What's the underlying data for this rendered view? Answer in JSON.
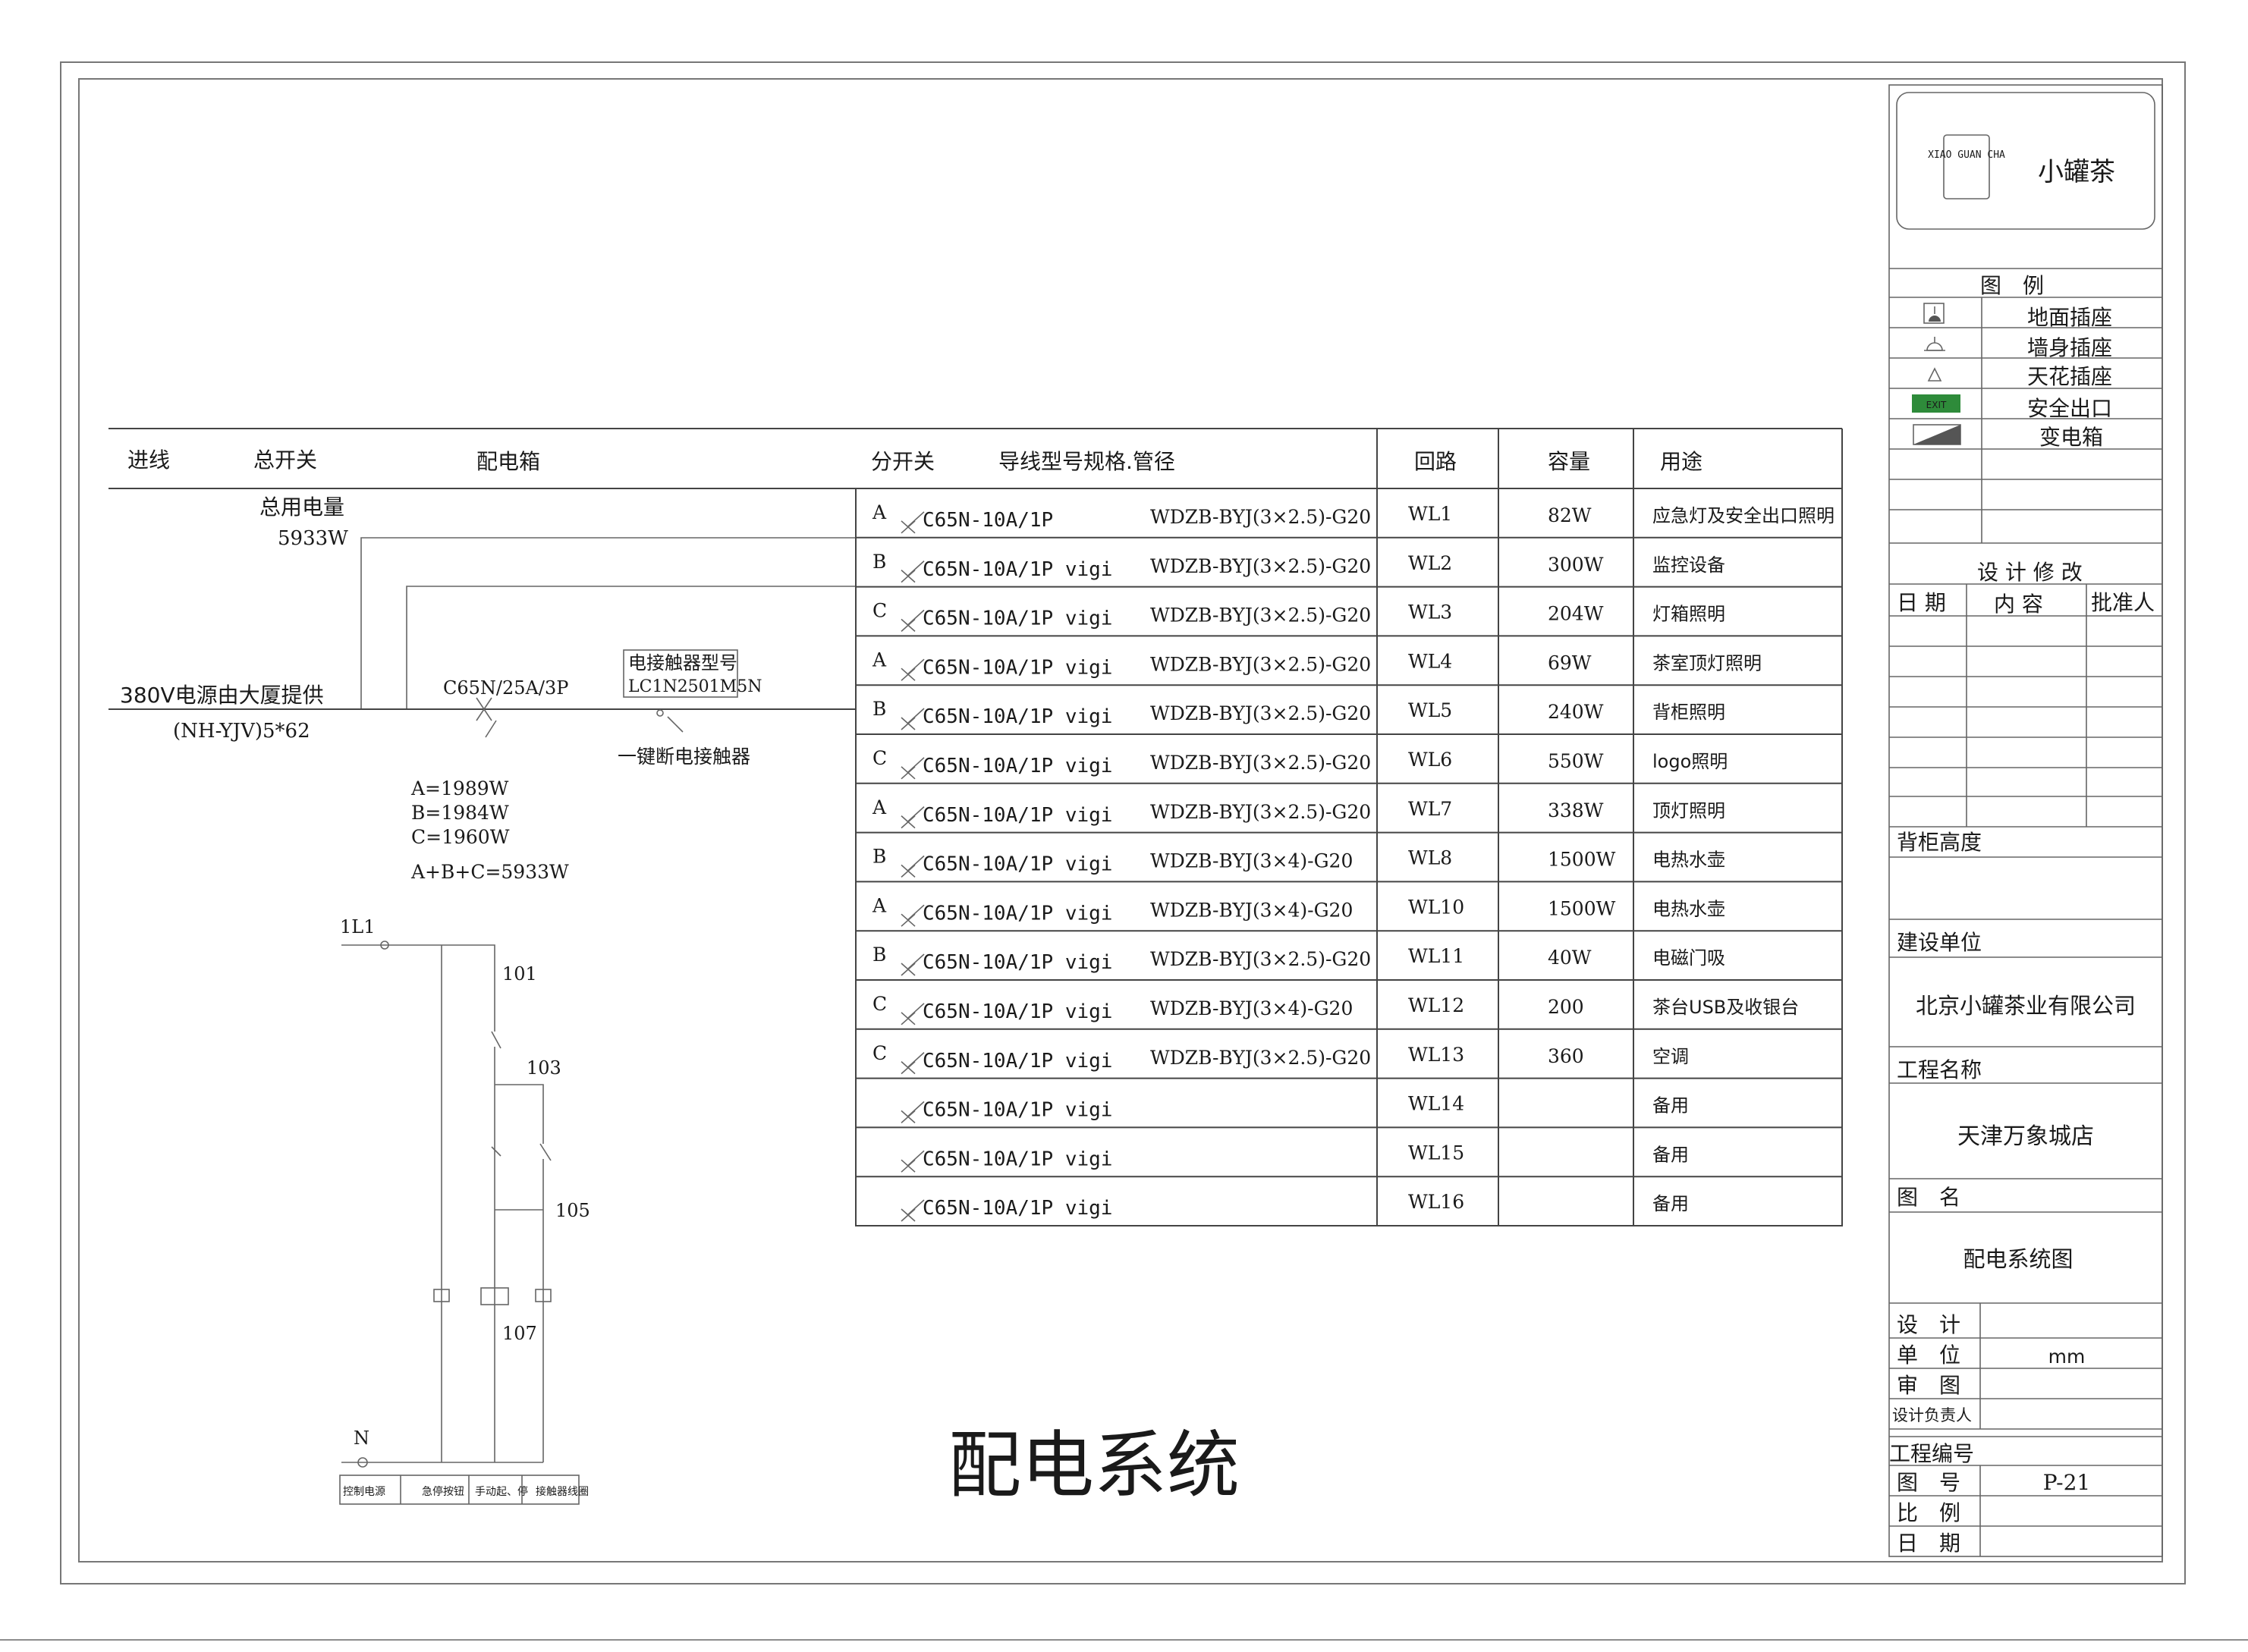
{
  "header": {
    "incoming": "进线",
    "main_switch": "总开关",
    "distribution_box": "配电箱",
    "branch_switch": "分开关",
    "wire_spec": "导线型号规格.管径",
    "circuit": "回路",
    "capacity": "容量",
    "usage": "用途"
  },
  "total_power": {
    "label": "总用电量",
    "value": "5933W"
  },
  "supply": {
    "text": "380V电源由大厦提供",
    "cable": "(NH-YJV)5*62"
  },
  "main_breaker": "C65N/25A/3P",
  "contactor": {
    "title": "电接触器型号",
    "model": "LC1N2501M5N",
    "caption": "一键断电接触器"
  },
  "phase_loads": {
    "a": "A=1989W",
    "b": "B=1984W",
    "c": "C=1960W",
    "total": "A+B+C=5933W"
  },
  "circuits": [
    {
      "phase": "A",
      "breaker": "C65N-10A/1P",
      "wire": "WDZB-BYJ(3×2.5)-G20",
      "id": "WL1",
      "capacity": "82W",
      "usage": "应急灯及安全出口照明"
    },
    {
      "phase": "B",
      "breaker": "C65N-10A/1P vigi",
      "wire": "WDZB-BYJ(3×2.5)-G20",
      "id": "WL2",
      "capacity": "300W",
      "usage": "监控设备"
    },
    {
      "phase": "C",
      "breaker": "C65N-10A/1P vigi",
      "wire": "WDZB-BYJ(3×2.5)-G20",
      "id": "WL3",
      "capacity": "204W",
      "usage": "灯箱照明"
    },
    {
      "phase": "A",
      "breaker": "C65N-10A/1P vigi",
      "wire": "WDZB-BYJ(3×2.5)-G20",
      "id": "WL4",
      "capacity": "69W",
      "usage": "茶室顶灯照明"
    },
    {
      "phase": "B",
      "breaker": "C65N-10A/1P vigi",
      "wire": "WDZB-BYJ(3×2.5)-G20",
      "id": "WL5",
      "capacity": "240W",
      "usage": "背柜照明"
    },
    {
      "phase": "C",
      "breaker": "C65N-10A/1P vigi",
      "wire": "WDZB-BYJ(3×2.5)-G20",
      "id": "WL6",
      "capacity": "550W",
      "usage": "logo照明"
    },
    {
      "phase": "A",
      "breaker": "C65N-10A/1P vigi",
      "wire": "WDZB-BYJ(3×2.5)-G20",
      "id": "WL7",
      "capacity": "338W",
      "usage": "顶灯照明"
    },
    {
      "phase": "B",
      "breaker": "C65N-10A/1P vigi",
      "wire": "WDZB-BYJ(3×4)-G20",
      "id": "WL8",
      "capacity": "1500W",
      "usage": "电热水壶"
    },
    {
      "phase": "A",
      "breaker": "C65N-10A/1P vigi",
      "wire": "WDZB-BYJ(3×4)-G20",
      "id": "WL10",
      "capacity": "1500W",
      "usage": "电热水壶"
    },
    {
      "phase": "B",
      "breaker": "C65N-10A/1P vigi",
      "wire": "WDZB-BYJ(3×2.5)-G20",
      "id": "WL11",
      "capacity": "40W",
      "usage": "电磁门吸"
    },
    {
      "phase": "C",
      "breaker": "C65N-10A/1P vigi",
      "wire": "WDZB-BYJ(3×4)-G20",
      "id": "WL12",
      "capacity": "200",
      "usage": "茶台USB及收银台"
    },
    {
      "phase": "C",
      "breaker": "C65N-10A/1P vigi",
      "wire": "WDZB-BYJ(3×2.5)-G20",
      "id": "WL13",
      "capacity": "360",
      "usage": "空调"
    },
    {
      "phase": "",
      "breaker": "C65N-10A/1P vigi",
      "wire": "",
      "id": "WL14",
      "capacity": "",
      "usage": "备用"
    },
    {
      "phase": "",
      "breaker": "C65N-10A/1P vigi",
      "wire": "",
      "id": "WL15",
      "capacity": "",
      "usage": "备用"
    },
    {
      "phase": "",
      "breaker": "C65N-10A/1P vigi",
      "wire": "",
      "id": "WL16",
      "capacity": "",
      "usage": "备用"
    }
  ],
  "control": {
    "l1": "1L1",
    "n": "N",
    "wires": [
      "101",
      "103",
      "105",
      "107"
    ],
    "legend": [
      "控制电源",
      "急停按钮",
      "手动起、停",
      "接触器线圈"
    ]
  },
  "title": "配电系统",
  "titleblock": {
    "logo_brand": "小罐茶",
    "logo_mark": "XIAO GUAN CHA",
    "legend_title": "图　例",
    "legend_items": [
      "地面插座",
      "墙身插座",
      "天花插座",
      "安全出口",
      "变电箱"
    ],
    "exit_sign": "EXIT",
    "revision_title": "设 计 修 改",
    "rev_date": "日 期",
    "rev_content": "内 容",
    "rev_approver": "批准人",
    "cabinet_height": "背柜高度",
    "client_label": "建设单位",
    "client": "北京小罐茶业有限公司",
    "project_label": "工程名称",
    "project": "天津万象城店",
    "drawing_label": "图　名",
    "drawing": "配电系统图",
    "design": "设　计",
    "unit": "单　位",
    "unit_value": "mm",
    "review": "审　图",
    "design_lead": "设计负责人",
    "project_no": "工程编号",
    "sheet_no_label": "图　号",
    "sheet_no": "P-21",
    "scale": "比　例",
    "date": "日　期"
  }
}
